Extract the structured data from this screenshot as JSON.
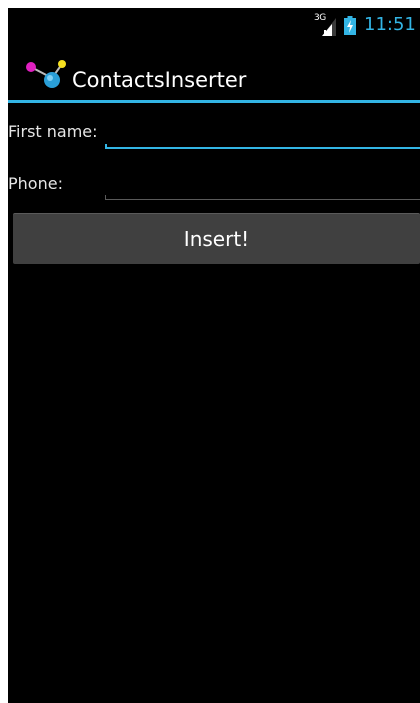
{
  "status_bar": {
    "network_type": "3G",
    "time": "11:51",
    "signal_icon": "cell-signal-icon",
    "battery_icon": "battery-charging-icon"
  },
  "action_bar": {
    "title": "ContactsInserter",
    "icon": "app-molecule-icon"
  },
  "form": {
    "first_name_label": "First name:",
    "first_name_value": "",
    "phone_label": "Phone:",
    "phone_value": "",
    "insert_button_label": "Insert!"
  },
  "colors": {
    "accent": "#33b5e5",
    "background": "#000000",
    "button": "#404040"
  }
}
